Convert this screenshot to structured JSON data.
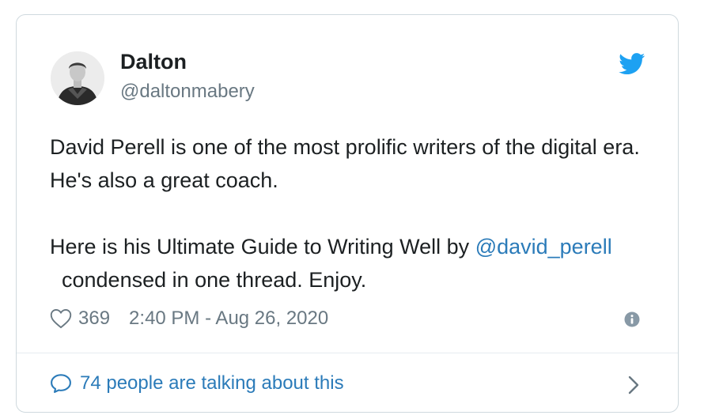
{
  "tweet": {
    "author_name": "Dalton",
    "author_handle": "@daltonmabery",
    "paragraph1": "David Perell is one of the most prolific writers of the digital era. He's also a great coach.",
    "paragraph2_prefix": "Here is his Ultimate Guide to Writing Well by ",
    "mention": "@david_perell",
    "paragraph2_suffix": "  condensed in one thread. Enjoy.",
    "likes": "369",
    "timestamp": "2:40 PM - Aug 26, 2020",
    "footer_text": "74 people are talking about this"
  },
  "icons": {
    "brand": "twitter-bird-icon",
    "like": "heart-icon",
    "info": "info-icon",
    "reply": "speech-bubble-icon",
    "next": "chevron-right-icon"
  },
  "colors": {
    "text": "#1c2022",
    "muted": "#697882",
    "link": "#2b7bb9",
    "twitter_blue": "#1da1f2",
    "border": "#cfd9de"
  }
}
